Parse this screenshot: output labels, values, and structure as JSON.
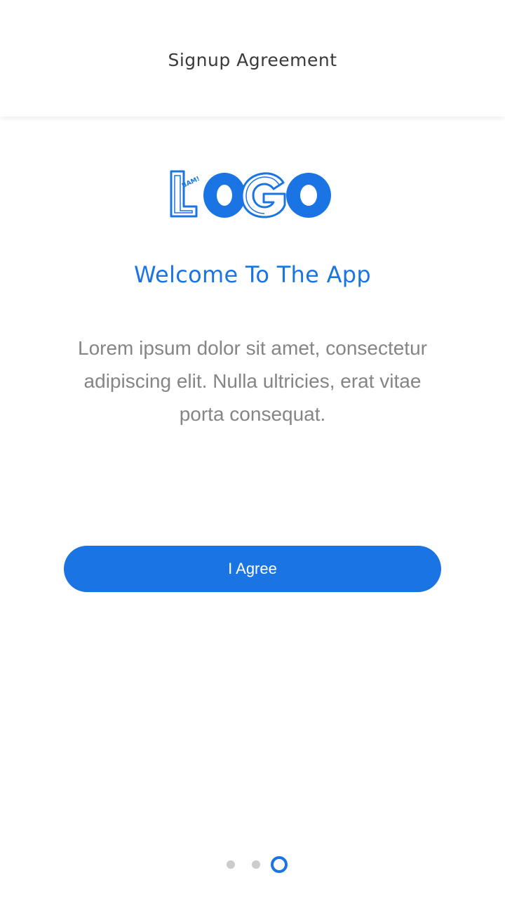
{
  "header": {
    "title": "Signup Agreement"
  },
  "logo": {
    "text": "LOGO",
    "badge_text": "BAM!",
    "icon": "logo-mark"
  },
  "main": {
    "heading": "Welcome To The App",
    "body": "Lorem ipsum dolor sit amet, consectetur adipiscing elit. Nulla ultricies, erat vitae porta consequat."
  },
  "actions": {
    "agree_label": "I Agree"
  },
  "pager": {
    "total": 3,
    "active_index": 3
  },
  "colors": {
    "accent": "#1b74e4",
    "text_body": "#858585",
    "title": "#3a3a3a",
    "dot_inactive": "#cccccc"
  }
}
